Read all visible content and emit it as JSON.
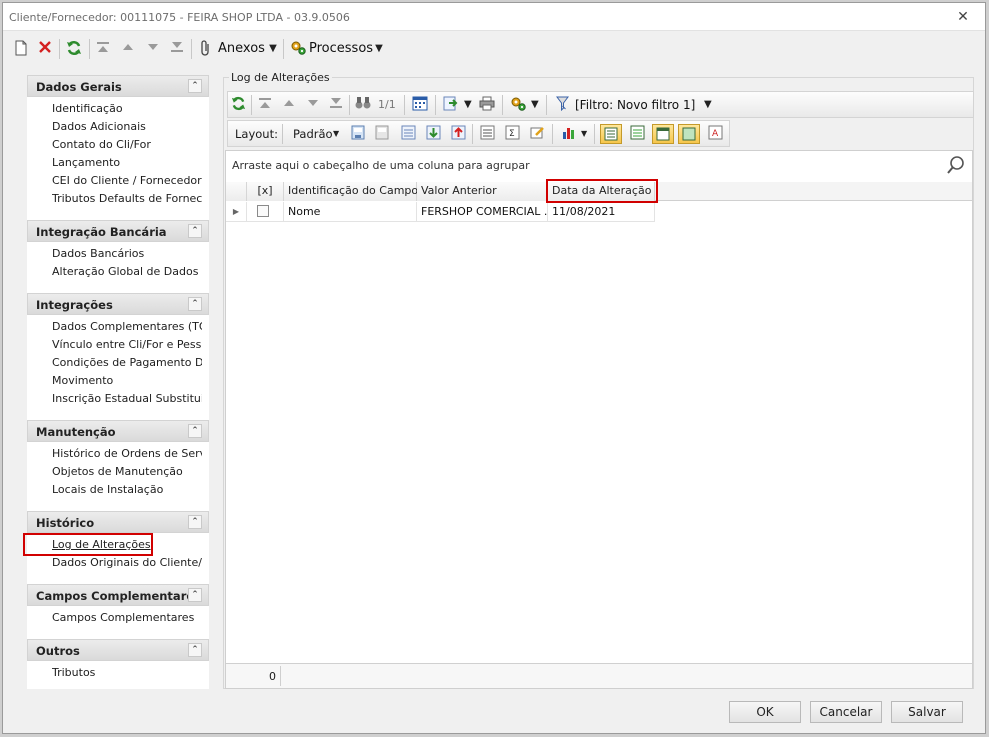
{
  "window": {
    "title": "Cliente/Fornecedor: 00111075 - FEIRA SHOP LTDA - 03.9.0506",
    "close_glyph": "✕"
  },
  "toolbar": {
    "anexos_label": "Anexos",
    "processos_label": "Processos",
    "icons": [
      "new-icon",
      "delete-icon",
      "refresh-icon",
      "first-icon",
      "prev-icon",
      "next-icon",
      "last-icon",
      "paperclip-icon",
      "gears-icon"
    ]
  },
  "sidebar": {
    "sections": [
      {
        "title": "Dados Gerais",
        "items": [
          "Identificação",
          "Dados Adicionais",
          "Contato do Cli/For",
          "Lançamento",
          "CEI do Cliente / Fornecedor",
          "Tributos Defaults de Fornec..."
        ]
      },
      {
        "title": "Integração Bancária",
        "items": [
          "Dados Bancários",
          "Alteração Global de Dados B..."
        ]
      },
      {
        "title": "Integrações",
        "items": [
          "Dados Complementares (TO...",
          "Vínculo entre Cli/For e Pessoa",
          "Condições de Pagamento De...",
          "Movimento",
          "Inscrição Estadual Substituiç..."
        ]
      },
      {
        "title": "Manutenção",
        "items": [
          "Histórico de Ordens de Servi...",
          "Objetos de Manutenção",
          "Locais de Instalação"
        ]
      },
      {
        "title": "Histórico",
        "items": [
          "Log de Alterações",
          "Dados Originais do Cliente/F..."
        ]
      },
      {
        "title": "Campos Complementares",
        "items": [
          "Campos Complementares"
        ]
      },
      {
        "title": "Outros",
        "items": [
          "Tributos"
        ]
      }
    ],
    "selected": "Log de Alterações"
  },
  "panel": {
    "title": "Log de Alterações",
    "pager": "1/1",
    "filter_label": "[Filtro: Novo filtro 1]",
    "layout_label": "Layout:",
    "layout_value": "Padrão",
    "groupby_hint": "Arraste aqui o cabeçalho de uma coluna para agrupar"
  },
  "grid": {
    "columns": [
      "[x]",
      "Identificação do Campo",
      "Valor Anterior",
      "Data da Alteração"
    ],
    "rows": [
      {
        "campo": "Nome",
        "valor_anterior": "FERSHOP COMERCIAL ...",
        "data": "11/08/2021"
      }
    ],
    "footer_count": "0"
  },
  "buttons": {
    "ok": "OK",
    "cancelar": "Cancelar",
    "salvar": "Salvar"
  },
  "colors": {
    "highlight_red": "#d10000",
    "accent_green": "#2e8b2e"
  }
}
